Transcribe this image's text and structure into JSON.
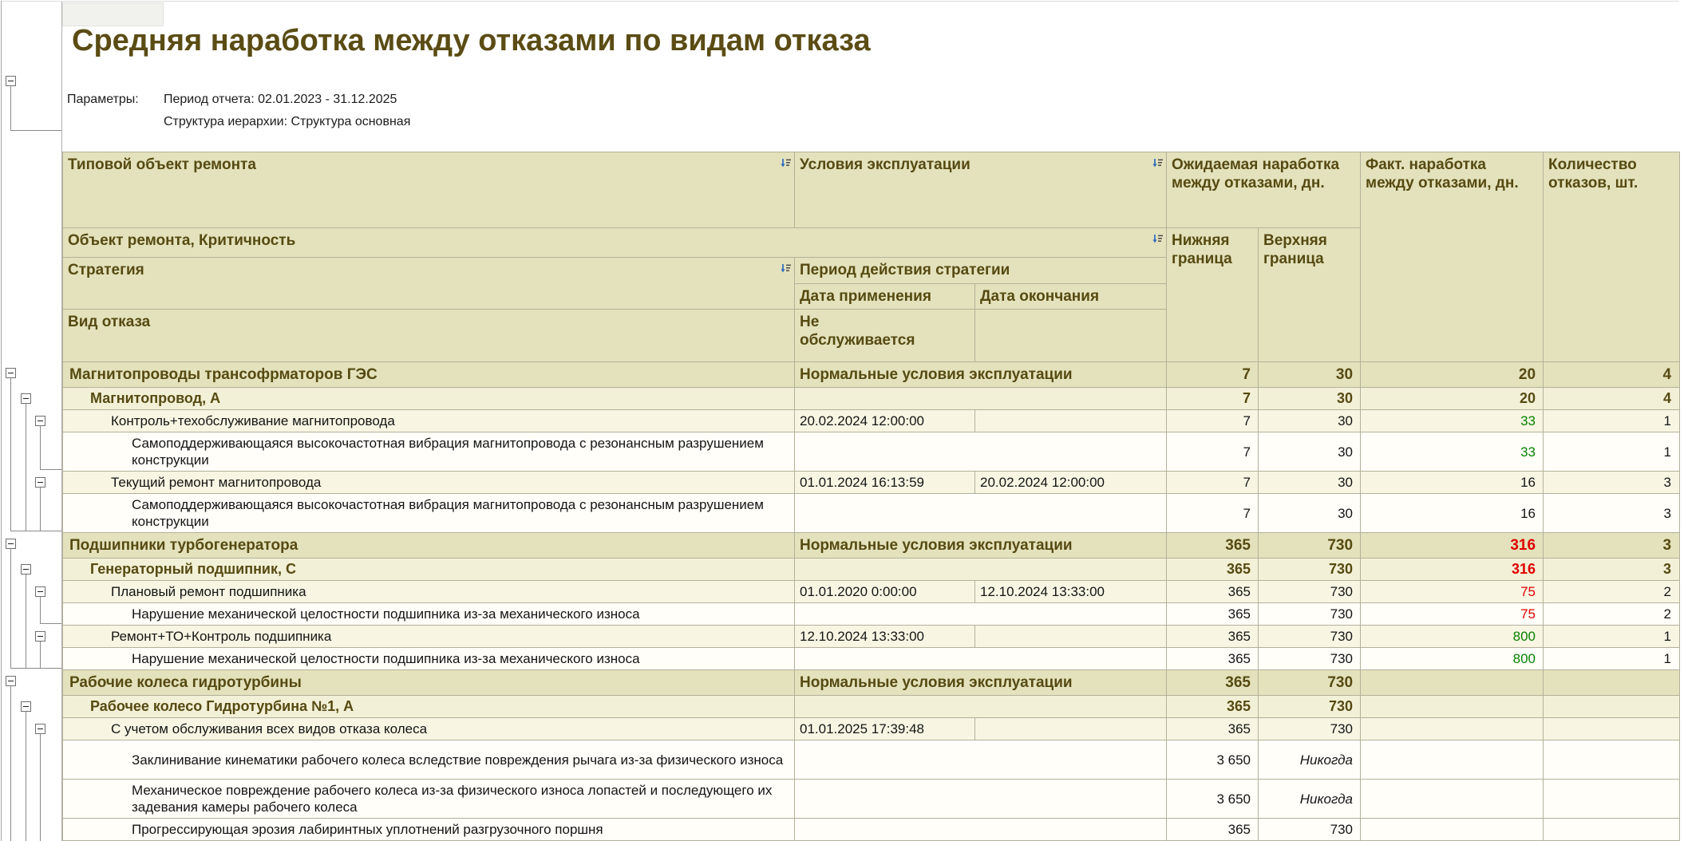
{
  "report": {
    "title": "Средняя наработка между отказами по видам отказа",
    "params_label": "Параметры:",
    "params_line1": "Период отчета: 02.01.2023 - 31.12.2025",
    "params_line2": "Структура иерархии: Структура основная"
  },
  "icons": {
    "sort": "sort-ascending-icon",
    "collapse": "collapse-minus-icon"
  },
  "colors": {
    "accent_text": "#564a12",
    "header_bg": "#e3e2bc",
    "row_level2_bg": "#f2f0d6",
    "row_level3_bg": "#f8f6e3",
    "row_detail_bg": "#fffef8",
    "fact_red": "#e00000",
    "fact_green": "#068200"
  },
  "header": {
    "col_object": "Типовой объект ремонта",
    "col_conditions": "Условия эксплуатации",
    "col_expected": "Ожидаемая наработка между отказами, дн.",
    "col_fact": "Факт. наработка между отказами, дн.",
    "col_count": "Количество отказов, шт.",
    "row2": "Объект ремонта, Критичность",
    "col_lower": "Нижняя граница",
    "col_upper": "Верхняя граница",
    "col_strategy": "Стратегия",
    "col_period": "Период действия стратегии",
    "col_date_from": "Дата применения",
    "col_date_to": "Дата окончания",
    "col_failure": "Вид отказа",
    "not_serviced": "Не обслуживается"
  },
  "rows": [
    {
      "level": 1,
      "toggle": true,
      "name": "Магнитопроводы трансофрматоров ГЭС",
      "cond": "Нормальные условия эксплуатации",
      "date_from": "",
      "date_to": "",
      "low": "7",
      "high": "30",
      "fact": "20",
      "fact_color": "",
      "count": "4",
      "lines": 1,
      "high_italic": false
    },
    {
      "level": 2,
      "toggle": true,
      "name": "Магнитопровод, А",
      "cond": "",
      "date_from": "",
      "date_to": "",
      "low": "7",
      "high": "30",
      "fact": "20",
      "fact_color": "",
      "count": "4",
      "lines": 1,
      "high_italic": false
    },
    {
      "level": 3,
      "toggle": true,
      "name": "Контроль+техобслуживание магнитопровода",
      "cond": "",
      "date_from": "20.02.2024 12:00:00",
      "date_to": "",
      "low": "7",
      "high": "30",
      "fact": "33",
      "fact_color": "green",
      "count": "1",
      "lines": 1,
      "high_italic": false
    },
    {
      "level": 4,
      "toggle": false,
      "name": "Самоподдерживающаяся высокочастотная вибрация магнитопровода с резонансным разрушением конструкции",
      "cond": "",
      "date_from": "",
      "date_to": "",
      "low": "7",
      "high": "30",
      "fact": "33",
      "fact_color": "green",
      "count": "1",
      "lines": 2,
      "high_italic": false
    },
    {
      "level": 3,
      "toggle": true,
      "name": "Текущий ремонт магнитопровода",
      "cond": "",
      "date_from": "01.01.2024 16:13:59",
      "date_to": "20.02.2024 12:00:00",
      "low": "7",
      "high": "30",
      "fact": "16",
      "fact_color": "",
      "count": "3",
      "lines": 1,
      "high_italic": false
    },
    {
      "level": 4,
      "toggle": false,
      "name": "Самоподдерживающаяся высокочастотная вибрация магнитопровода с резонансным разрушением конструкции",
      "cond": "",
      "date_from": "",
      "date_to": "",
      "low": "7",
      "high": "30",
      "fact": "16",
      "fact_color": "",
      "count": "3",
      "lines": 2,
      "high_italic": false
    },
    {
      "level": 1,
      "toggle": true,
      "name": "Подшипники турбогенератора",
      "cond": "Нормальные условия эксплуатации",
      "date_from": "",
      "date_to": "",
      "low": "365",
      "high": "730",
      "fact": "316",
      "fact_color": "red",
      "count": "3",
      "lines": 1,
      "high_italic": false
    },
    {
      "level": 2,
      "toggle": true,
      "name": "Генераторный подшипник, С",
      "cond": "",
      "date_from": "",
      "date_to": "",
      "low": "365",
      "high": "730",
      "fact": "316",
      "fact_color": "red",
      "count": "3",
      "lines": 1,
      "high_italic": false
    },
    {
      "level": 3,
      "toggle": true,
      "name": "Плановый ремонт подшипника",
      "cond": "",
      "date_from": "01.01.2020 0:00:00",
      "date_to": "12.10.2024 13:33:00",
      "low": "365",
      "high": "730",
      "fact": "75",
      "fact_color": "red",
      "count": "2",
      "lines": 1,
      "high_italic": false
    },
    {
      "level": 4,
      "toggle": false,
      "name": "Нарушение механической целостности подшипника из-за механического износа",
      "cond": "",
      "date_from": "",
      "date_to": "",
      "low": "365",
      "high": "730",
      "fact": "75",
      "fact_color": "red",
      "count": "2",
      "lines": 1,
      "high_italic": false
    },
    {
      "level": 3,
      "toggle": true,
      "name": "Ремонт+ТО+Контроль подшипника",
      "cond": "",
      "date_from": "12.10.2024 13:33:00",
      "date_to": "",
      "low": "365",
      "high": "730",
      "fact": "800",
      "fact_color": "green",
      "count": "1",
      "lines": 1,
      "high_italic": false
    },
    {
      "level": 4,
      "toggle": false,
      "name": "Нарушение механической целостности подшипника из-за механического износа",
      "cond": "",
      "date_from": "",
      "date_to": "",
      "low": "365",
      "high": "730",
      "fact": "800",
      "fact_color": "green",
      "count": "1",
      "lines": 1,
      "high_italic": false
    },
    {
      "level": 1,
      "toggle": true,
      "name": "Рабочие колеса гидротурбины",
      "cond": "Нормальные условия эксплуатации",
      "date_from": "",
      "date_to": "",
      "low": "365",
      "high": "730",
      "fact": "",
      "fact_color": "",
      "count": "",
      "lines": 1,
      "high_italic": false
    },
    {
      "level": 2,
      "toggle": true,
      "name": "Рабочее колесо Гидротурбина №1, А",
      "cond": "",
      "date_from": "",
      "date_to": "",
      "low": "365",
      "high": "730",
      "fact": "",
      "fact_color": "",
      "count": "",
      "lines": 1,
      "high_italic": false
    },
    {
      "level": 3,
      "toggle": true,
      "name": "С учетом обслуживания всех видов отказа колеса",
      "cond": "",
      "date_from": "01.01.2025 17:39:48",
      "date_to": "",
      "low": "365",
      "high": "730",
      "fact": "",
      "fact_color": "",
      "count": "",
      "lines": 1,
      "high_italic": false
    },
    {
      "level": 4,
      "toggle": false,
      "name": "Заклинивание кинематики рабочего колеса вследствие повреждения рычага из-за физического износа",
      "cond": "",
      "date_from": "",
      "date_to": "",
      "low": "3 650",
      "high": "Никогда",
      "fact": "",
      "fact_color": "",
      "count": "",
      "lines": 2,
      "high_italic": true
    },
    {
      "level": 4,
      "toggle": false,
      "name": "Механическое повреждение рабочего колеса из-за физического износа лопастей и последующего их задевания камеры рабочего колеса",
      "cond": "",
      "date_from": "",
      "date_to": "",
      "low": "3 650",
      "high": "Никогда",
      "fact": "",
      "fact_color": "",
      "count": "",
      "lines": 2,
      "high_italic": true
    },
    {
      "level": 4,
      "toggle": false,
      "name": "Прогрессирующая эрозия лабиринтных уплотнений разгрузочного поршня",
      "cond": "",
      "date_from": "",
      "date_to": "",
      "low": "365",
      "high": "730",
      "fact": "",
      "fact_color": "",
      "count": "",
      "lines": 1,
      "high_italic": false
    }
  ]
}
